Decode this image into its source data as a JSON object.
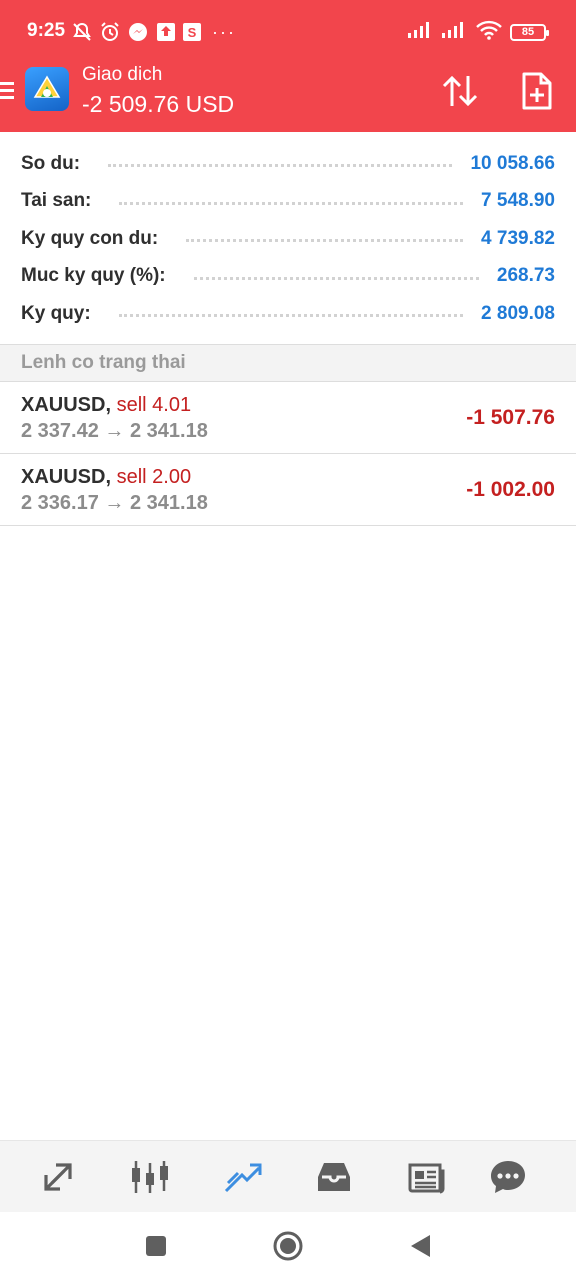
{
  "status_bar": {
    "time": "9:25",
    "battery": "85",
    "notification_icons": [
      "mute-icon",
      "alarm-icon",
      "messenger-icon",
      "upload-icon",
      "s-icon"
    ],
    "s_label": "S",
    "more": "···"
  },
  "appbar": {
    "title": "Giao dich",
    "subtitle": "-2 509.76 USD",
    "accent": "#f2454c"
  },
  "summary": [
    {
      "label": "So du:",
      "value": "10 058.66"
    },
    {
      "label": "Tai san:",
      "value": "7 548.90"
    },
    {
      "label": "Ky quy con du:",
      "value": "4 739.82"
    },
    {
      "label": "Muc ky quy (%):",
      "value": "268.73"
    },
    {
      "label": "Ky quy:",
      "value": "2 809.08"
    }
  ],
  "section_title": "Lenh co trang thai",
  "orders": [
    {
      "symbol": "XAUUSD,",
      "side": "sell 4.01",
      "prices": "2 337.42 → 2 341.18",
      "profit": "-1 507.76"
    },
    {
      "symbol": "XAUUSD,",
      "side": "sell 2.00",
      "prices": "2 336.17 → 2 341.18",
      "profit": "-1 002.00"
    }
  ],
  "bottom_nav": [
    {
      "icon": "quotes-icon",
      "active": false
    },
    {
      "icon": "chart-icon",
      "active": false
    },
    {
      "icon": "trade-icon",
      "active": true
    },
    {
      "icon": "history-icon",
      "active": false
    },
    {
      "icon": "news-icon",
      "active": false
    },
    {
      "icon": "chat-icon",
      "active": false
    }
  ],
  "colors": {
    "header": "#f2454c",
    "value_blue": "#1f7ad6",
    "loss_red": "#c42020",
    "active_nav": "#3d8ee0",
    "inactive_nav": "#5f5f5f"
  }
}
